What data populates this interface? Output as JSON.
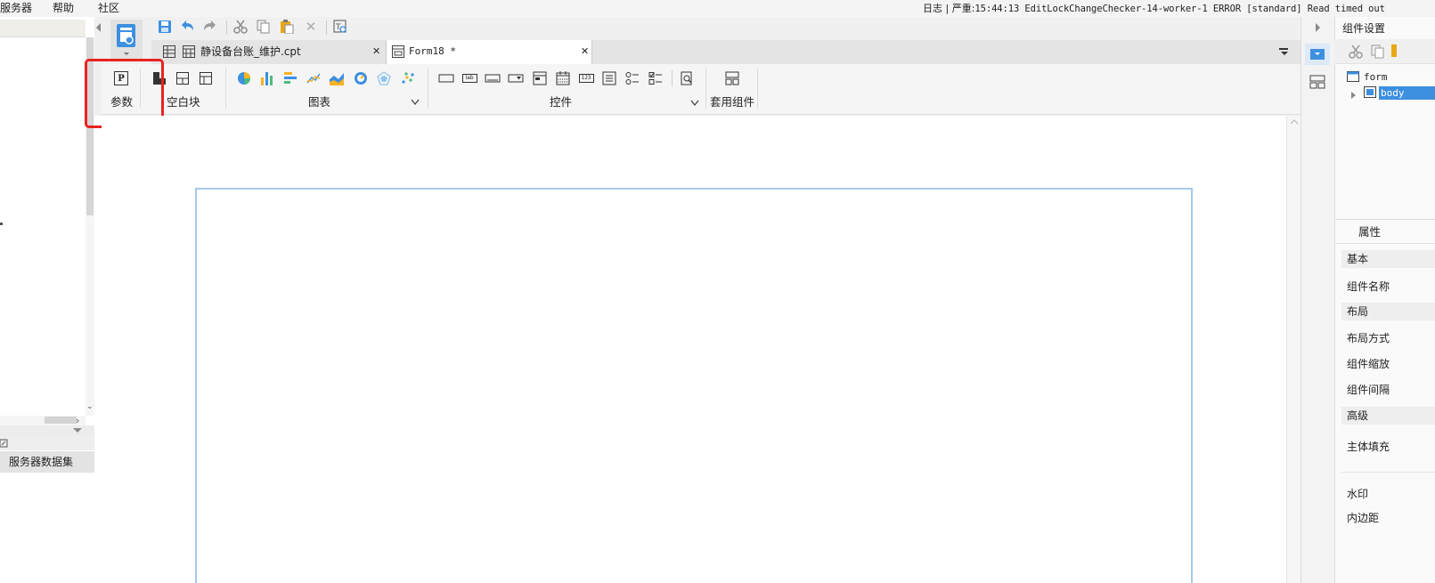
{
  "menubar": {
    "items": [
      "服务器",
      "帮助",
      "社区"
    ],
    "log_prefix": "日志 | 严重:",
    "log_message": "15:44:13 EditLockChangeChecker-14-worker-1 ERROR [standard] Read timed out"
  },
  "left_panel": {
    "server_dataset_label": "服务器数据集"
  },
  "tabs": [
    {
      "label": "静设备台账_维护.cpt",
      "close": "✕"
    },
    {
      "label": "Form18 *",
      "close": "✕"
    }
  ],
  "widget_toolbar": {
    "param_icon": "P",
    "param_label": "参数",
    "blank_label": "空白块",
    "chart_label": "图表",
    "controls_label": "控件",
    "template_label": "套用组件",
    "lab_icon_text": "lab",
    "num_icon_text": "123"
  },
  "right_panel": {
    "title": "组件设置",
    "tree": {
      "root": "form",
      "child": "body"
    },
    "properties_title": "属性",
    "sections": {
      "basic": "基本",
      "layout": "布局",
      "advanced": "高级"
    },
    "fields": {
      "component_name": "组件名称",
      "layout_mode": "布局方式",
      "component_scale": "组件缩放",
      "component_spacing": "组件间隔",
      "body_fill": "主体填充",
      "watermark": "水印",
      "padding": "内边距"
    }
  },
  "colors": {
    "highlight": "#e8231f",
    "form_border": "#a9c8ec",
    "accent_blue": "#3d8fe0"
  },
  "icons": [
    "save-icon",
    "undo-icon",
    "redo-icon",
    "cut-icon",
    "copy-icon",
    "paste-icon",
    "delete-icon",
    "preview-icon",
    "pie-chart-icon",
    "bar-chart-icon",
    "line-chart-icon",
    "area-chart-icon",
    "gauge-chart-icon",
    "radar-chart-icon",
    "scatter-chart-icon"
  ]
}
